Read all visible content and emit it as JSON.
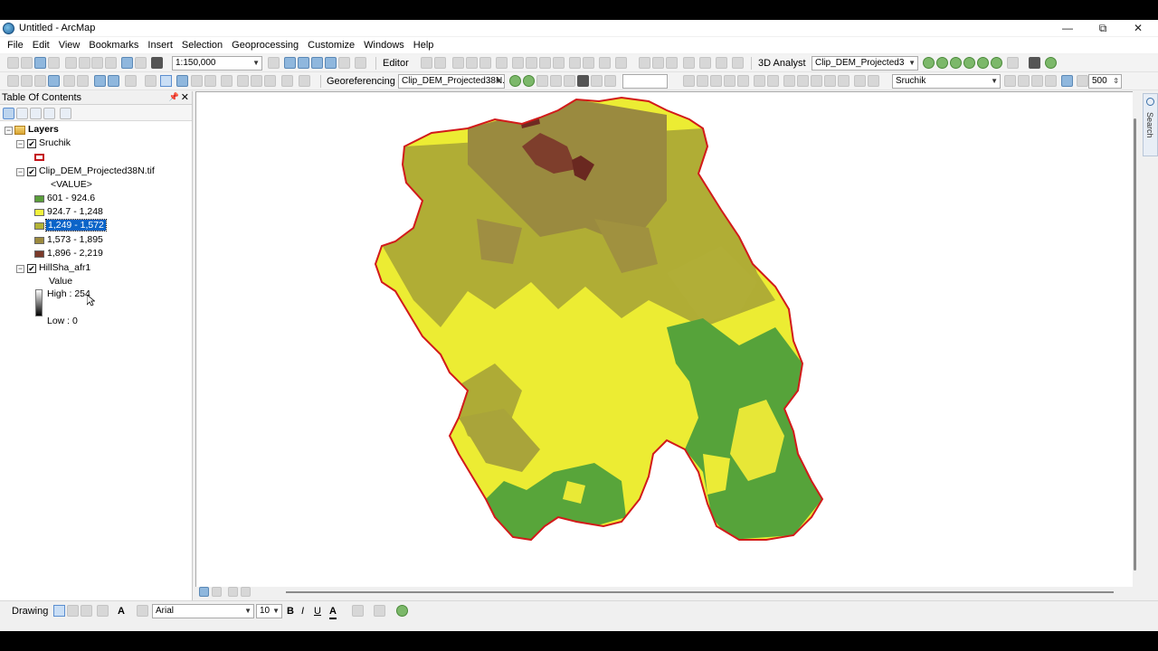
{
  "window": {
    "title": "Untitled - ArcMap",
    "controls": [
      "—",
      "⧉",
      "✕"
    ]
  },
  "menu": [
    "File",
    "Edit",
    "View",
    "Bookmarks",
    "Insert",
    "Selection",
    "Geoprocessing",
    "Customize",
    "Windows",
    "Help"
  ],
  "toolbar1": {
    "scale": "1:150,000",
    "editor": "Editor",
    "analyst3d": "3D Analyst",
    "analyst_layer": "Clip_DEM_Projected3"
  },
  "toolbar2": {
    "georeferencing": "Georeferencing",
    "geo_layer": "Clip_DEM_Projected38N.",
    "layer_select": "Sruchik",
    "zoom_value": "500"
  },
  "toc": {
    "title": "Table Of Contents",
    "root": "Layers",
    "layers": [
      {
        "name": "Sruchik"
      },
      {
        "name": "Clip_DEM_Projected38N.tif",
        "field": "<VALUE>",
        "classes": [
          {
            "label": "601 - 924.6",
            "color": "#5a9e3a"
          },
          {
            "label": "924.7 - 1,248",
            "color": "#f2f23c"
          },
          {
            "label": "1,249 - 1,572",
            "color": "#b3b336"
          },
          {
            "label": "1,573 - 1,895",
            "color": "#9c8a3e"
          },
          {
            "label": "1,896 - 2,219",
            "color": "#7a3a2a"
          }
        ]
      },
      {
        "name": "HillSha_afr1",
        "field": "Value",
        "high": "High : 254",
        "low": "Low : 0"
      }
    ]
  },
  "drawing": {
    "label": "Drawing",
    "font": "Arial",
    "size": "10",
    "bold": "B",
    "italic": "I",
    "underline": "U",
    "font_color": "A"
  },
  "side_tab": "Search",
  "colors": {
    "boundary": "#d21a1a",
    "selection": "#0a64c8"
  }
}
